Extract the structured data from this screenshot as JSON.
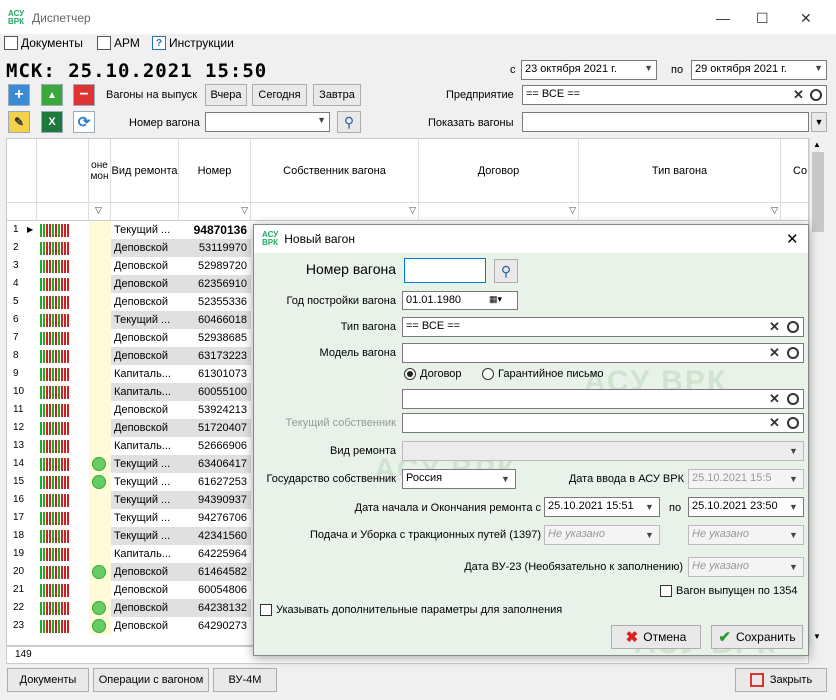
{
  "window": {
    "title": "Диспетчер",
    "logo": "АСУ ВРК"
  },
  "menu": [
    {
      "label": "Документы",
      "icon": "documents-icon"
    },
    {
      "label": "АРМ",
      "icon": "arm-icon"
    },
    {
      "label": "Инструкции",
      "icon": "help-icon"
    }
  ],
  "clock": "МСК: 25.10.2021 15:50",
  "toolbar": {
    "wagons_out_label": "Вагоны на выпуск",
    "yesterday": "Вчера",
    "today": "Сегодня",
    "tomorrow": "Завтра",
    "wagon_number_label": "Номер вагона",
    "wagon_number_value": "",
    "date_from_prefix": "с",
    "date_from": "23 октября  2021 г.",
    "date_to_prefix": "по",
    "date_to": "29 октября  2021 г.",
    "enterprise_label": "Предприятие",
    "enterprise_value": "== ВСЕ ==",
    "show_wagons_label": "Показать вагоны",
    "show_wagons_value": ""
  },
  "grid": {
    "columns": [
      "",
      "",
      "оне мон",
      "Вид ремонта",
      "Номер",
      "Собственник вагона",
      "Договор",
      "Тип вагона",
      "Со"
    ],
    "rows": [
      {
        "n": "1",
        "repair": "Текущий ...",
        "number": "94870136",
        "dot": false,
        "bold": true
      },
      {
        "n": "2",
        "repair": "Деповской",
        "number": "53119970",
        "dot": false
      },
      {
        "n": "3",
        "repair": "Деповской",
        "number": "52989720",
        "dot": false
      },
      {
        "n": "4",
        "repair": "Деповской",
        "number": "62356910",
        "dot": false
      },
      {
        "n": "5",
        "repair": "Деповской",
        "number": "52355336",
        "dot": false
      },
      {
        "n": "6",
        "repair": "Текущий ...",
        "number": "60466018",
        "dot": false
      },
      {
        "n": "7",
        "repair": "Деповской",
        "number": "52938685",
        "dot": false
      },
      {
        "n": "8",
        "repair": "Деповской",
        "number": "63173223",
        "dot": false
      },
      {
        "n": "9",
        "repair": "Капиталь...",
        "number": "61301073",
        "dot": false
      },
      {
        "n": "10",
        "repair": "Капиталь...",
        "number": "60055100",
        "dot": false
      },
      {
        "n": "11",
        "repair": "Деповской",
        "number": "53924213",
        "dot": false
      },
      {
        "n": "12",
        "repair": "Деповской",
        "number": "51720407",
        "dot": false
      },
      {
        "n": "13",
        "repair": "Капиталь...",
        "number": "52666906",
        "dot": false
      },
      {
        "n": "14",
        "repair": "Текущий ...",
        "number": "63406417",
        "dot": true
      },
      {
        "n": "15",
        "repair": "Текущий ...",
        "number": "61627253",
        "dot": true
      },
      {
        "n": "16",
        "repair": "Текущий ...",
        "number": "94390937",
        "dot": false
      },
      {
        "n": "17",
        "repair": "Текущий ...",
        "number": "94276706",
        "dot": false
      },
      {
        "n": "18",
        "repair": "Текущий ...",
        "number": "42341560",
        "dot": false
      },
      {
        "n": "19",
        "repair": "Капиталь...",
        "number": "64225964",
        "dot": false
      },
      {
        "n": "20",
        "repair": "Деповской",
        "number": "61464582",
        "dot": true
      },
      {
        "n": "21",
        "repair": "Деповской",
        "number": "60054806",
        "dot": false
      },
      {
        "n": "22",
        "repair": "Деповской",
        "number": "64238132",
        "dot": true
      },
      {
        "n": "23",
        "repair": "Деповской",
        "number": "64290273",
        "dot": true
      }
    ],
    "count": "149"
  },
  "bottom": {
    "documents": "Документы",
    "operations": "Операции с вагоном",
    "vu4m": "ВУ-4М",
    "close": "Закрыть"
  },
  "dialog": {
    "title": "Новый вагон",
    "watermark": "АСУ ВРК",
    "wagon_number_label": "Номер вагона",
    "wagon_number_value": "",
    "build_year_label": "Год постройки вагона",
    "build_year_value": "01.01.1980",
    "type_label": "Тип вагона",
    "type_value": "== ВСЕ ==",
    "model_label": "Модель вагона",
    "model_value": "",
    "radio_contract": "Договор",
    "radio_guarantee": "Гарантийное письмо",
    "contract_value": "",
    "current_owner_label": "Текущий собственник",
    "current_owner_value": "",
    "repair_type_label": "Вид ремонта",
    "repair_type_value": "",
    "state_owner_label": "Государство собственник",
    "state_owner_value": "Россия",
    "entry_date_label": "Дата ввода в АСУ ВРК",
    "entry_date_value": "25.10.2021 15:5",
    "repair_dates_label": "Дата начала и Окончания ремонта с",
    "repair_start": "25.10.2021 15:51",
    "repair_to_label": "по",
    "repair_end": "25.10.2021 23:50",
    "traction_label": "Подача и Уборка с тракционных путей (1397)",
    "traction_from": "Не указано",
    "traction_to": "Не указано",
    "vu23_label": "Дата ВУ-23 (Необязательно к заполнению)",
    "vu23_value": "Не указано",
    "released_label": "Вагон выпущен по 1354",
    "extra_params_label": "Указывать дополнительные параметры для заполнения",
    "cancel": "Отмена",
    "save": "Сохранить"
  },
  "colors": {
    "accent": "#0078d7",
    "green": "#33aa33",
    "red": "#cc2222"
  }
}
